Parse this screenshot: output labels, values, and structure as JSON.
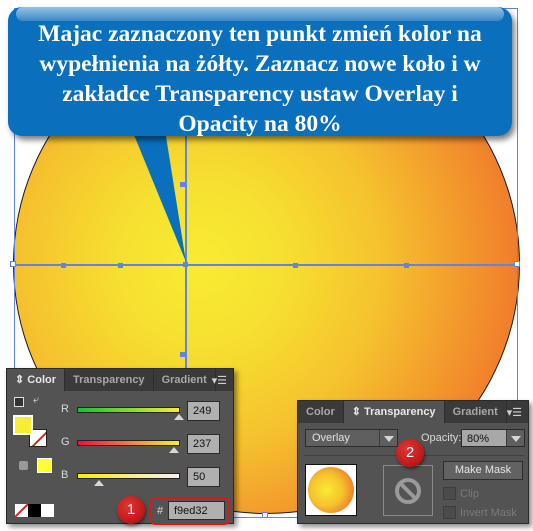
{
  "callout": {
    "lines": [
      "Majac zaznaczony ten punkt zmień kolor na",
      "wypełnienia na żółty. Zaznacz nowe koło i w",
      "zakładce Transparency ustaw Overlay i",
      "Opacity na 80%"
    ],
    "color": "#0a70be"
  },
  "colors": {
    "circle_center": "#f8ec32",
    "circle_edge": "#ef5a2a",
    "selection": "#5b86e5",
    "badge": "#c41e1e"
  },
  "color_panel": {
    "tabs": [
      {
        "label": "Color",
        "active": true,
        "icon": "updown-arrows-icon"
      },
      {
        "label": "Transparency",
        "active": false
      },
      {
        "label": "Gradient",
        "active": false
      }
    ],
    "menu_icon": "panel-menu-icon",
    "channels": [
      {
        "label": "R",
        "value": "249",
        "fraction": 0.976
      },
      {
        "label": "G",
        "value": "237",
        "fraction": 0.929
      },
      {
        "label": "B",
        "value": "50",
        "fraction": 0.196
      }
    ],
    "hex_label": "#",
    "hex_value": "f9ed32",
    "fill_color": "#f9ed32",
    "web_swatch_color": "#ffff33",
    "badge": "1"
  },
  "transparency_panel": {
    "tabs": [
      {
        "label": "Color",
        "active": false
      },
      {
        "label": "Transparency",
        "active": true,
        "icon": "updown-arrows-icon"
      },
      {
        "label": "Gradient",
        "active": false
      }
    ],
    "menu_icon": "panel-menu-icon",
    "blend_mode": "Overlay",
    "opacity_label": "Opacity:",
    "opacity_value": "80%",
    "make_mask_label": "Make Mask",
    "clip_label": "Clip",
    "invert_mask_label": "Invert Mask",
    "badge": "2"
  }
}
